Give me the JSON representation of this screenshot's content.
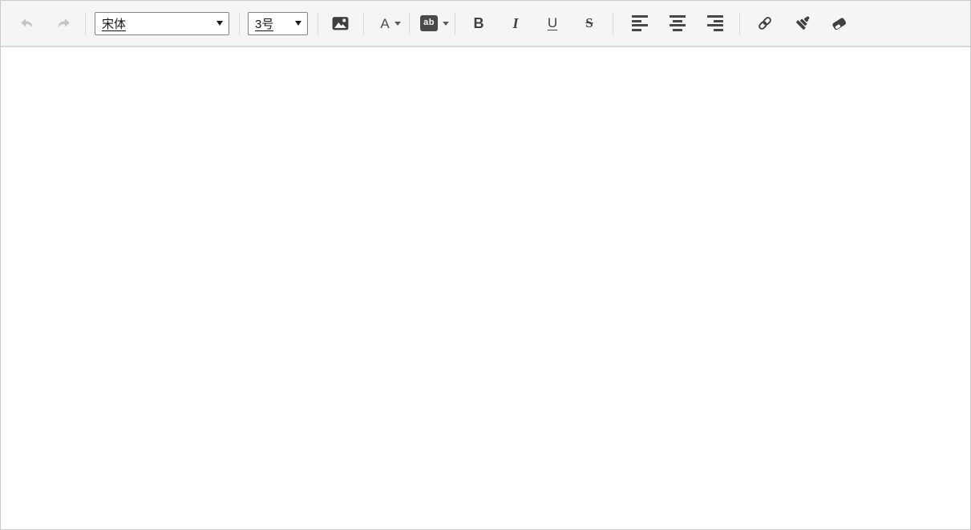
{
  "toolbar": {
    "undo": {
      "icon": "undo-arrow",
      "enabled": false
    },
    "redo": {
      "icon": "redo-arrow",
      "enabled": false
    },
    "font_family": {
      "value": "宋体"
    },
    "font_size": {
      "value": "3号"
    },
    "insert_image": {
      "icon": "image"
    },
    "font_color": {
      "label": "A",
      "icon": "caret-down"
    },
    "highlight": {
      "label": "ab",
      "icon": "caret-down"
    },
    "bold": {
      "label": "B"
    },
    "italic": {
      "label": "I"
    },
    "underline": {
      "label": "U"
    },
    "strikethrough": {
      "label": "S"
    },
    "align_left": {
      "icon": "align-left"
    },
    "align_center": {
      "icon": "align-center"
    },
    "align_right": {
      "icon": "align-right"
    },
    "link": {
      "icon": "chain-link"
    },
    "format_brush": {
      "icon": "paint-brush"
    },
    "clear_format": {
      "icon": "eraser"
    }
  },
  "colors": {
    "toolbar_bg": "#f5f5f5",
    "toolbar_border": "#cfdae2",
    "outer_border": "#c9c9c9",
    "separator": "#d6d6d6",
    "icon": "#404040",
    "icon_disabled": "#c4c4c4",
    "badge_bg": "#4a4a4a",
    "badge_text": "#ffffff"
  },
  "content": {
    "text": ""
  }
}
